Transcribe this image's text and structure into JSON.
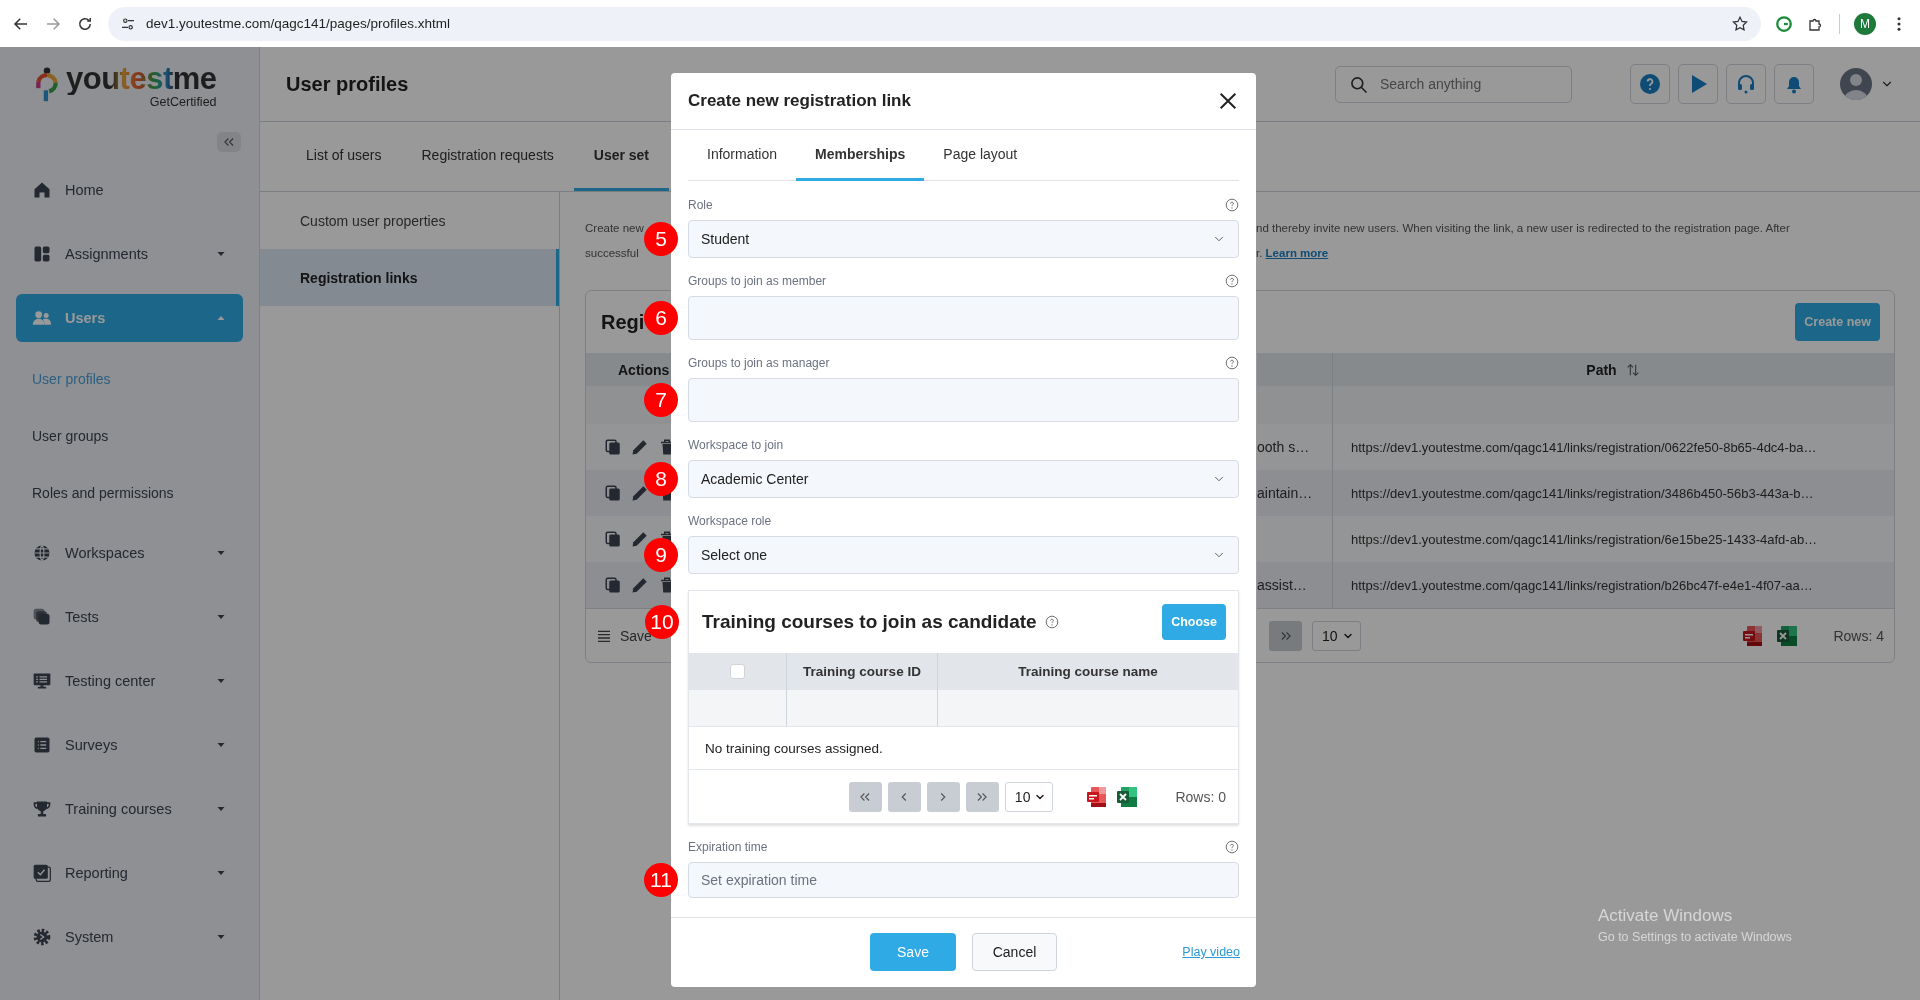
{
  "browser": {
    "url": "dev1.youtestme.com/qagc141/pages/profiles.xhtml",
    "profile_initial": "M"
  },
  "sidebar": {
    "logo": "youtestme",
    "tagline": "GetCertified",
    "items": [
      {
        "label": "Home",
        "selected": false
      },
      {
        "label": "Assignments",
        "selected": false,
        "expanded": false
      },
      {
        "label": "Users",
        "selected": true,
        "expanded": true,
        "children": [
          {
            "label": "User profiles",
            "selected": true
          },
          {
            "label": "User groups",
            "selected": false
          },
          {
            "label": "Roles and permissions",
            "selected": false
          }
        ]
      },
      {
        "label": "Workspaces",
        "selected": false,
        "expanded": false
      },
      {
        "label": "Tests",
        "selected": false,
        "expanded": false
      },
      {
        "label": "Testing center",
        "selected": false,
        "expanded": false
      },
      {
        "label": "Surveys",
        "selected": false,
        "expanded": false
      },
      {
        "label": "Training courses",
        "selected": false,
        "expanded": false
      },
      {
        "label": "Reporting",
        "selected": false,
        "expanded": false
      },
      {
        "label": "System",
        "selected": false,
        "expanded": false
      }
    ]
  },
  "page": {
    "title": "User profiles",
    "search": {
      "placeholder": "Search anything"
    },
    "tabs": [
      {
        "label": "List of users",
        "selected": false
      },
      {
        "label": "Registration requests",
        "selected": false
      },
      {
        "label": "User set",
        "selected": true
      }
    ],
    "subnav": [
      {
        "label": "Custom user properties",
        "selected": false
      },
      {
        "label": "Registration links",
        "selected": true
      }
    ],
    "description": {
      "left_lines": [
        "Create new",
        "successful"
      ],
      "right_line": "nd thereby invite new users. When visiting the link, a new user is redirected to the registration page. After",
      "right_tail": "r.",
      "link": "Learn more"
    },
    "table": {
      "title": "Regi",
      "create_button": "Create new",
      "columns": [
        "Actions",
        "Path"
      ],
      "rows": [
        {
          "column_3": "ooth s…",
          "path": "https://dev1.youtestme.com/qagc141/links/registration/0622fe50-8b65-4dc4-ba…"
        },
        {
          "column_3": "aintain…",
          "path": "https://dev1.youtestme.com/qagc141/links/registration/3486b450-56b3-443a-b…"
        },
        {
          "path": "https://dev1.youtestme.com/qagc141/links/registration/6e15be25-1433-4afd-ab…"
        },
        {
          "column_3": "assist…",
          "path": "https://dev1.youtestme.com/qagc141/links/registration/b26bc47f-e4e1-4f07-aa…"
        }
      ],
      "save_label": "Save",
      "page_size": "10",
      "rows_count": "Rows: 4"
    }
  },
  "modal": {
    "title": "Create new registration link",
    "tabs": [
      {
        "label": "Information",
        "selected": false
      },
      {
        "label": "Memberships",
        "selected": true
      },
      {
        "label": "Page layout",
        "selected": false
      }
    ],
    "fields": [
      {
        "kind": "select",
        "label": "Role",
        "value": "Student",
        "marker": "5",
        "help": true
      },
      {
        "kind": "text",
        "label": "Groups to join as member",
        "marker": "6",
        "help": true
      },
      {
        "kind": "text",
        "label": "Groups to join as manager",
        "marker": "7",
        "help": true
      },
      {
        "kind": "select",
        "label": "Workspace to join",
        "value": "Academic Center",
        "marker": "8",
        "help": false
      },
      {
        "kind": "select",
        "label": "Workspace role",
        "value": "Select one",
        "marker": "9",
        "help": false
      }
    ],
    "courses": {
      "marker": "10",
      "title": "Training courses to join as candidate",
      "choose_button": "Choose",
      "columns": [
        "Training course ID",
        "Training course name"
      ],
      "select_all_checked": false,
      "empty_message": "No training courses assigned.",
      "page_size": "10",
      "rows_count": "Rows: 0"
    },
    "expiration": {
      "label": "Expiration time",
      "placeholder": "Set expiration time",
      "marker": "11",
      "help": true
    },
    "save_button": "Save",
    "cancel_button": "Cancel",
    "link": "Play video"
  },
  "windows_notice": [
    "Activate Windows",
    "Go to Settings to activate Windows"
  ]
}
